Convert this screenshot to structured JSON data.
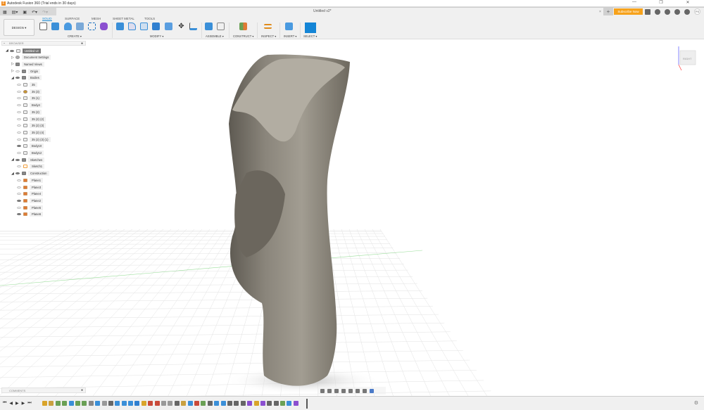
{
  "window": {
    "title": "Autodesk Fusion 360 (Trial ends in 30 days)",
    "controls": [
      "—",
      "❐",
      "✕"
    ]
  },
  "tabbar": {
    "document_tab": "Untitled v2*",
    "close": "×",
    "new_tab": "+",
    "subscribe": "Subscribe Now",
    "avatar": "PS"
  },
  "toolbar": {
    "tabs": [
      "SOLID",
      "SURFACE",
      "MESH",
      "SHEET METAL",
      "TOOLS"
    ],
    "workspace": "DESIGN ▾",
    "groups": [
      "CREATE ▾",
      "MODIFY ▾",
      "ASSEMBLE ▾",
      "CONSTRUCT ▾",
      "INSPECT ▾",
      "INSERT ▾",
      "SELECT ▾"
    ]
  },
  "browser": {
    "title": "BROWSER",
    "nodes": [
      {
        "label": "Untitled v2",
        "type": "doc"
      },
      {
        "label": "Document Settings",
        "type": "gear"
      },
      {
        "label": "Named Views",
        "type": "folder"
      },
      {
        "label": "Origin",
        "type": "folder"
      },
      {
        "label": "Bodies",
        "type": "folder"
      },
      {
        "label": "35",
        "type": "body"
      },
      {
        "label": "35 (3)",
        "type": "gold"
      },
      {
        "label": "35 (1)",
        "type": "body"
      },
      {
        "label": "Body4",
        "type": "body"
      },
      {
        "label": "35 (2)",
        "type": "body"
      },
      {
        "label": "35 (2) (2)",
        "type": "body"
      },
      {
        "label": "35 (2) (3)",
        "type": "body"
      },
      {
        "label": "35 (2) (4)",
        "type": "body"
      },
      {
        "label": "35 (2) (3) (1)",
        "type": "body"
      },
      {
        "label": "Body10",
        "type": "body"
      },
      {
        "label": "Body12",
        "type": "body"
      },
      {
        "label": "Sketches",
        "type": "folder"
      },
      {
        "label": "Sketch1",
        "type": "sketch"
      },
      {
        "label": "Construction",
        "type": "folder"
      },
      {
        "label": "Plane1",
        "type": "plane"
      },
      {
        "label": "Plane3",
        "type": "plane"
      },
      {
        "label": "Plane4",
        "type": "plane"
      },
      {
        "label": "Plane2",
        "type": "plane"
      },
      {
        "label": "Plane5",
        "type": "plane"
      },
      {
        "label": "Plane6",
        "type": "plane"
      }
    ]
  },
  "comments": {
    "title": "COMMENTS"
  },
  "viewcube": {
    "face": "RIGHT"
  },
  "timeline": {
    "controls": [
      "⏮",
      "◀",
      "▶",
      "▶",
      "⏭"
    ],
    "item_colors": [
      "#d9a42a",
      "#c9a040",
      "#6aa055",
      "#6aa055",
      "#3a8fd8",
      "#6aa055",
      "#6aa055",
      "#888",
      "#3a8fd8",
      "#999",
      "#666",
      "#3a8fd8",
      "#3a8fd8",
      "#3a8fd8",
      "#2f7fd0",
      "#d9a42a",
      "#c94a3a",
      "#c94a3a",
      "#999",
      "#999",
      "#666",
      "#c9a040",
      "#3a8fd8",
      "#c94a3a",
      "#6aa055",
      "#666",
      "#3a8fd8",
      "#3a8fd8",
      "#666",
      "#666",
      "#666",
      "#8b4fd0",
      "#d9a42a",
      "#8b4fd0",
      "#666",
      "#666",
      "#6aa055",
      "#3a8fd8",
      "#8b4fd0"
    ]
  }
}
